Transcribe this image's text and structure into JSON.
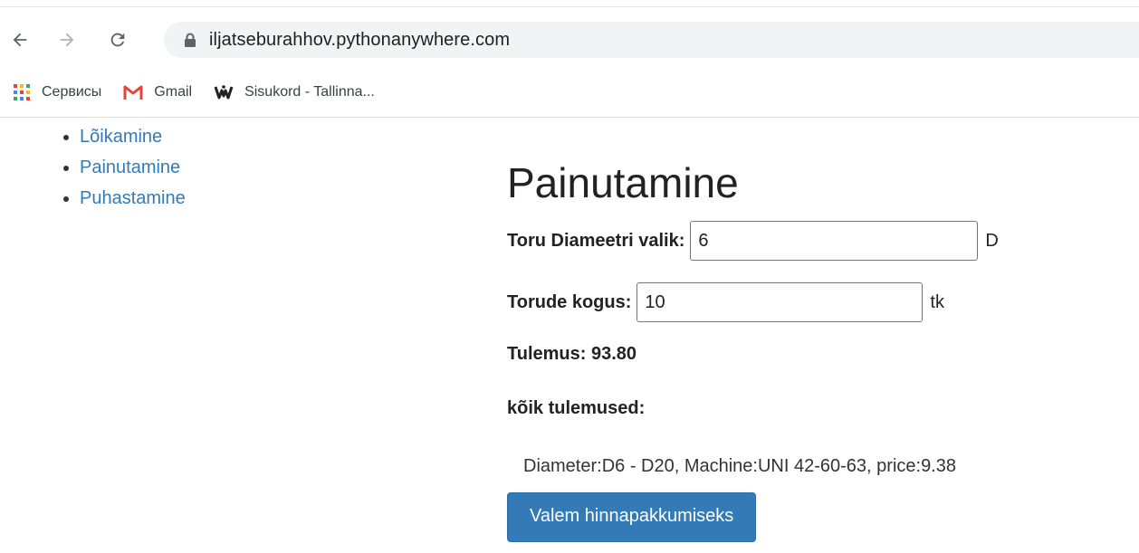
{
  "browser": {
    "url": "iljatseburahhov.pythonanywhere.com",
    "bookmarks": [
      {
        "label": "Сервисы",
        "icon": "apps-grid-icon"
      },
      {
        "label": "Gmail",
        "icon": "gmail-icon"
      },
      {
        "label": "Sisukord - Tallinna...",
        "icon": "weebly-icon"
      }
    ]
  },
  "sidenav": {
    "items": [
      {
        "label": "Lõikamine"
      },
      {
        "label": "Painutamine"
      },
      {
        "label": "Puhastamine"
      }
    ]
  },
  "main": {
    "title": "Painutamine",
    "diameter": {
      "label": "Toru Diameetri valik:",
      "value": "6",
      "unit": "D"
    },
    "quantity": {
      "label": "Torude kogus:",
      "value": "10",
      "unit": "tk"
    },
    "result": "Tulemus: 93.80",
    "all_results_label": "kõik tulemused:",
    "results_list": [
      "Diameter:D6 - D20, Machine:UNI 42-60-63, price:9.38"
    ],
    "button_label": "Valem hinnapakkumiseks"
  },
  "colors": {
    "link": "#337ab7",
    "button": "#337ab7",
    "gmail_red": "#ea4335"
  }
}
